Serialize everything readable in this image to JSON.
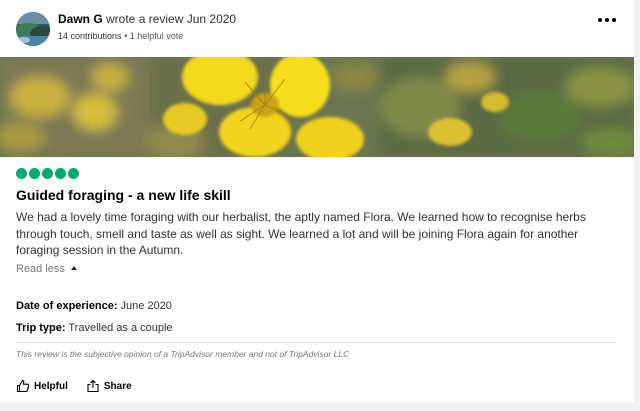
{
  "review": {
    "user": {
      "name": "Dawn G",
      "action": "wrote a review Jun 2020",
      "contributions": "14 contributions",
      "separator": "•",
      "helpful_votes": "1 helpful vote"
    },
    "rating": {
      "value": 5,
      "max": 5,
      "color": "#00aa6c"
    },
    "title": "Guided foraging - a new life skill",
    "body": "We had a lovely time foraging with our herbalist, the aptly named Flora. We learned how to recognise herbs through touch, smell and taste as well as sight. We learned a lot and will be joining Flora again for another foraging session in the Autumn.",
    "read_less_label": "Read less",
    "date_of_experience": {
      "label": "Date of experience:",
      "value": "June 2020"
    },
    "trip_type": {
      "label": "Trip type:",
      "value": "Travelled as a couple"
    },
    "disclaimer": "This review is the subjective opinion of a TripAdvisor member and not of TripAdvisor LLC",
    "actions": {
      "helpful_label": "Helpful",
      "share_label": "Share"
    },
    "icons": {
      "more": "more-options-icon",
      "helpful": "thumbs-up-icon",
      "share": "share-icon"
    }
  }
}
